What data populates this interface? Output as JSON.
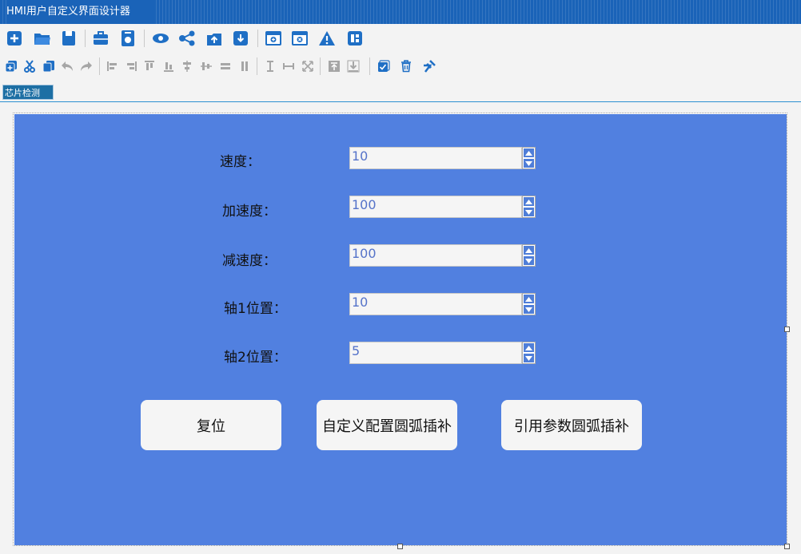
{
  "window": {
    "title": "HMI用户自定义界面设计器"
  },
  "toolbar1": [
    {
      "name": "new-page-icon",
      "color": "#1f6fc5"
    },
    {
      "name": "open-folder-icon",
      "color": "#1f6fc5"
    },
    {
      "name": "save-icon",
      "color": "#1f6fc5"
    },
    {
      "name": "toolbox-icon",
      "color": "#1f6fc5"
    },
    {
      "name": "device-settings-icon",
      "color": "#1f6fc5"
    },
    {
      "name": "preview-eye-icon",
      "color": "#1f6fc5"
    },
    {
      "name": "share-nodes-icon",
      "color": "#1f6fc5"
    },
    {
      "name": "upload-icon",
      "color": "#1f6fc5"
    },
    {
      "name": "download-icon",
      "color": "#1f6fc5"
    },
    {
      "name": "add-window-icon",
      "color": "#1f6fc5"
    },
    {
      "name": "close-window-icon",
      "color": "#1f6fc5"
    },
    {
      "name": "warning-icon",
      "color": "#1f6fc5"
    },
    {
      "name": "layout-icon",
      "color": "#1f6fc5"
    }
  ],
  "toolbar2": [
    {
      "name": "copy-icon",
      "color": "#1f6fc5"
    },
    {
      "name": "cut-icon",
      "color": "#1f6fc5"
    },
    {
      "name": "paste-icon",
      "color": "#1f6fc5"
    },
    {
      "name": "undo-icon",
      "color": "#a6a6a6"
    },
    {
      "name": "redo-icon",
      "color": "#a6a6a6"
    },
    {
      "name": "align-left-icon",
      "color": "#a6a6a6"
    },
    {
      "name": "align-right-icon",
      "color": "#a6a6a6"
    },
    {
      "name": "align-top-icon",
      "color": "#a6a6a6"
    },
    {
      "name": "align-bottom-icon",
      "color": "#a6a6a6"
    },
    {
      "name": "align-center-vertical-icon",
      "color": "#a6a6a6"
    },
    {
      "name": "align-center-horizontal-icon",
      "color": "#a6a6a6"
    },
    {
      "name": "distribute-horizontal-icon",
      "color": "#a6a6a6"
    },
    {
      "name": "distribute-vertical-icon",
      "color": "#a6a6a6"
    },
    {
      "name": "same-height-icon",
      "color": "#a6a6a6"
    },
    {
      "name": "same-width-icon",
      "color": "#a6a6a6"
    },
    {
      "name": "same-size-icon",
      "color": "#a6a6a6"
    },
    {
      "name": "bring-to-front-icon",
      "color": "#a6a6a6"
    },
    {
      "name": "send-to-back-icon",
      "color": "#a6a6a6"
    },
    {
      "name": "select-all-icon",
      "color": "#1f6fc5"
    },
    {
      "name": "delete-icon",
      "color": "#1f6fc5"
    },
    {
      "name": "clear-icon",
      "color": "#1f6fc5"
    }
  ],
  "tab": {
    "label": "芯片检测"
  },
  "canvas": {
    "background": "#5180e0",
    "fields": [
      {
        "label": "速度：",
        "value": "10"
      },
      {
        "label": "加速度：",
        "value": "100"
      },
      {
        "label": "减速度：",
        "value": "100"
      },
      {
        "label": "轴1位置：",
        "value": "10"
      },
      {
        "label": "轴2位置：",
        "value": "5"
      }
    ],
    "buttons": [
      {
        "label": "复位"
      },
      {
        "label": "自定义配置圆弧插补"
      },
      {
        "label": "引用参数圆弧插补"
      }
    ]
  }
}
